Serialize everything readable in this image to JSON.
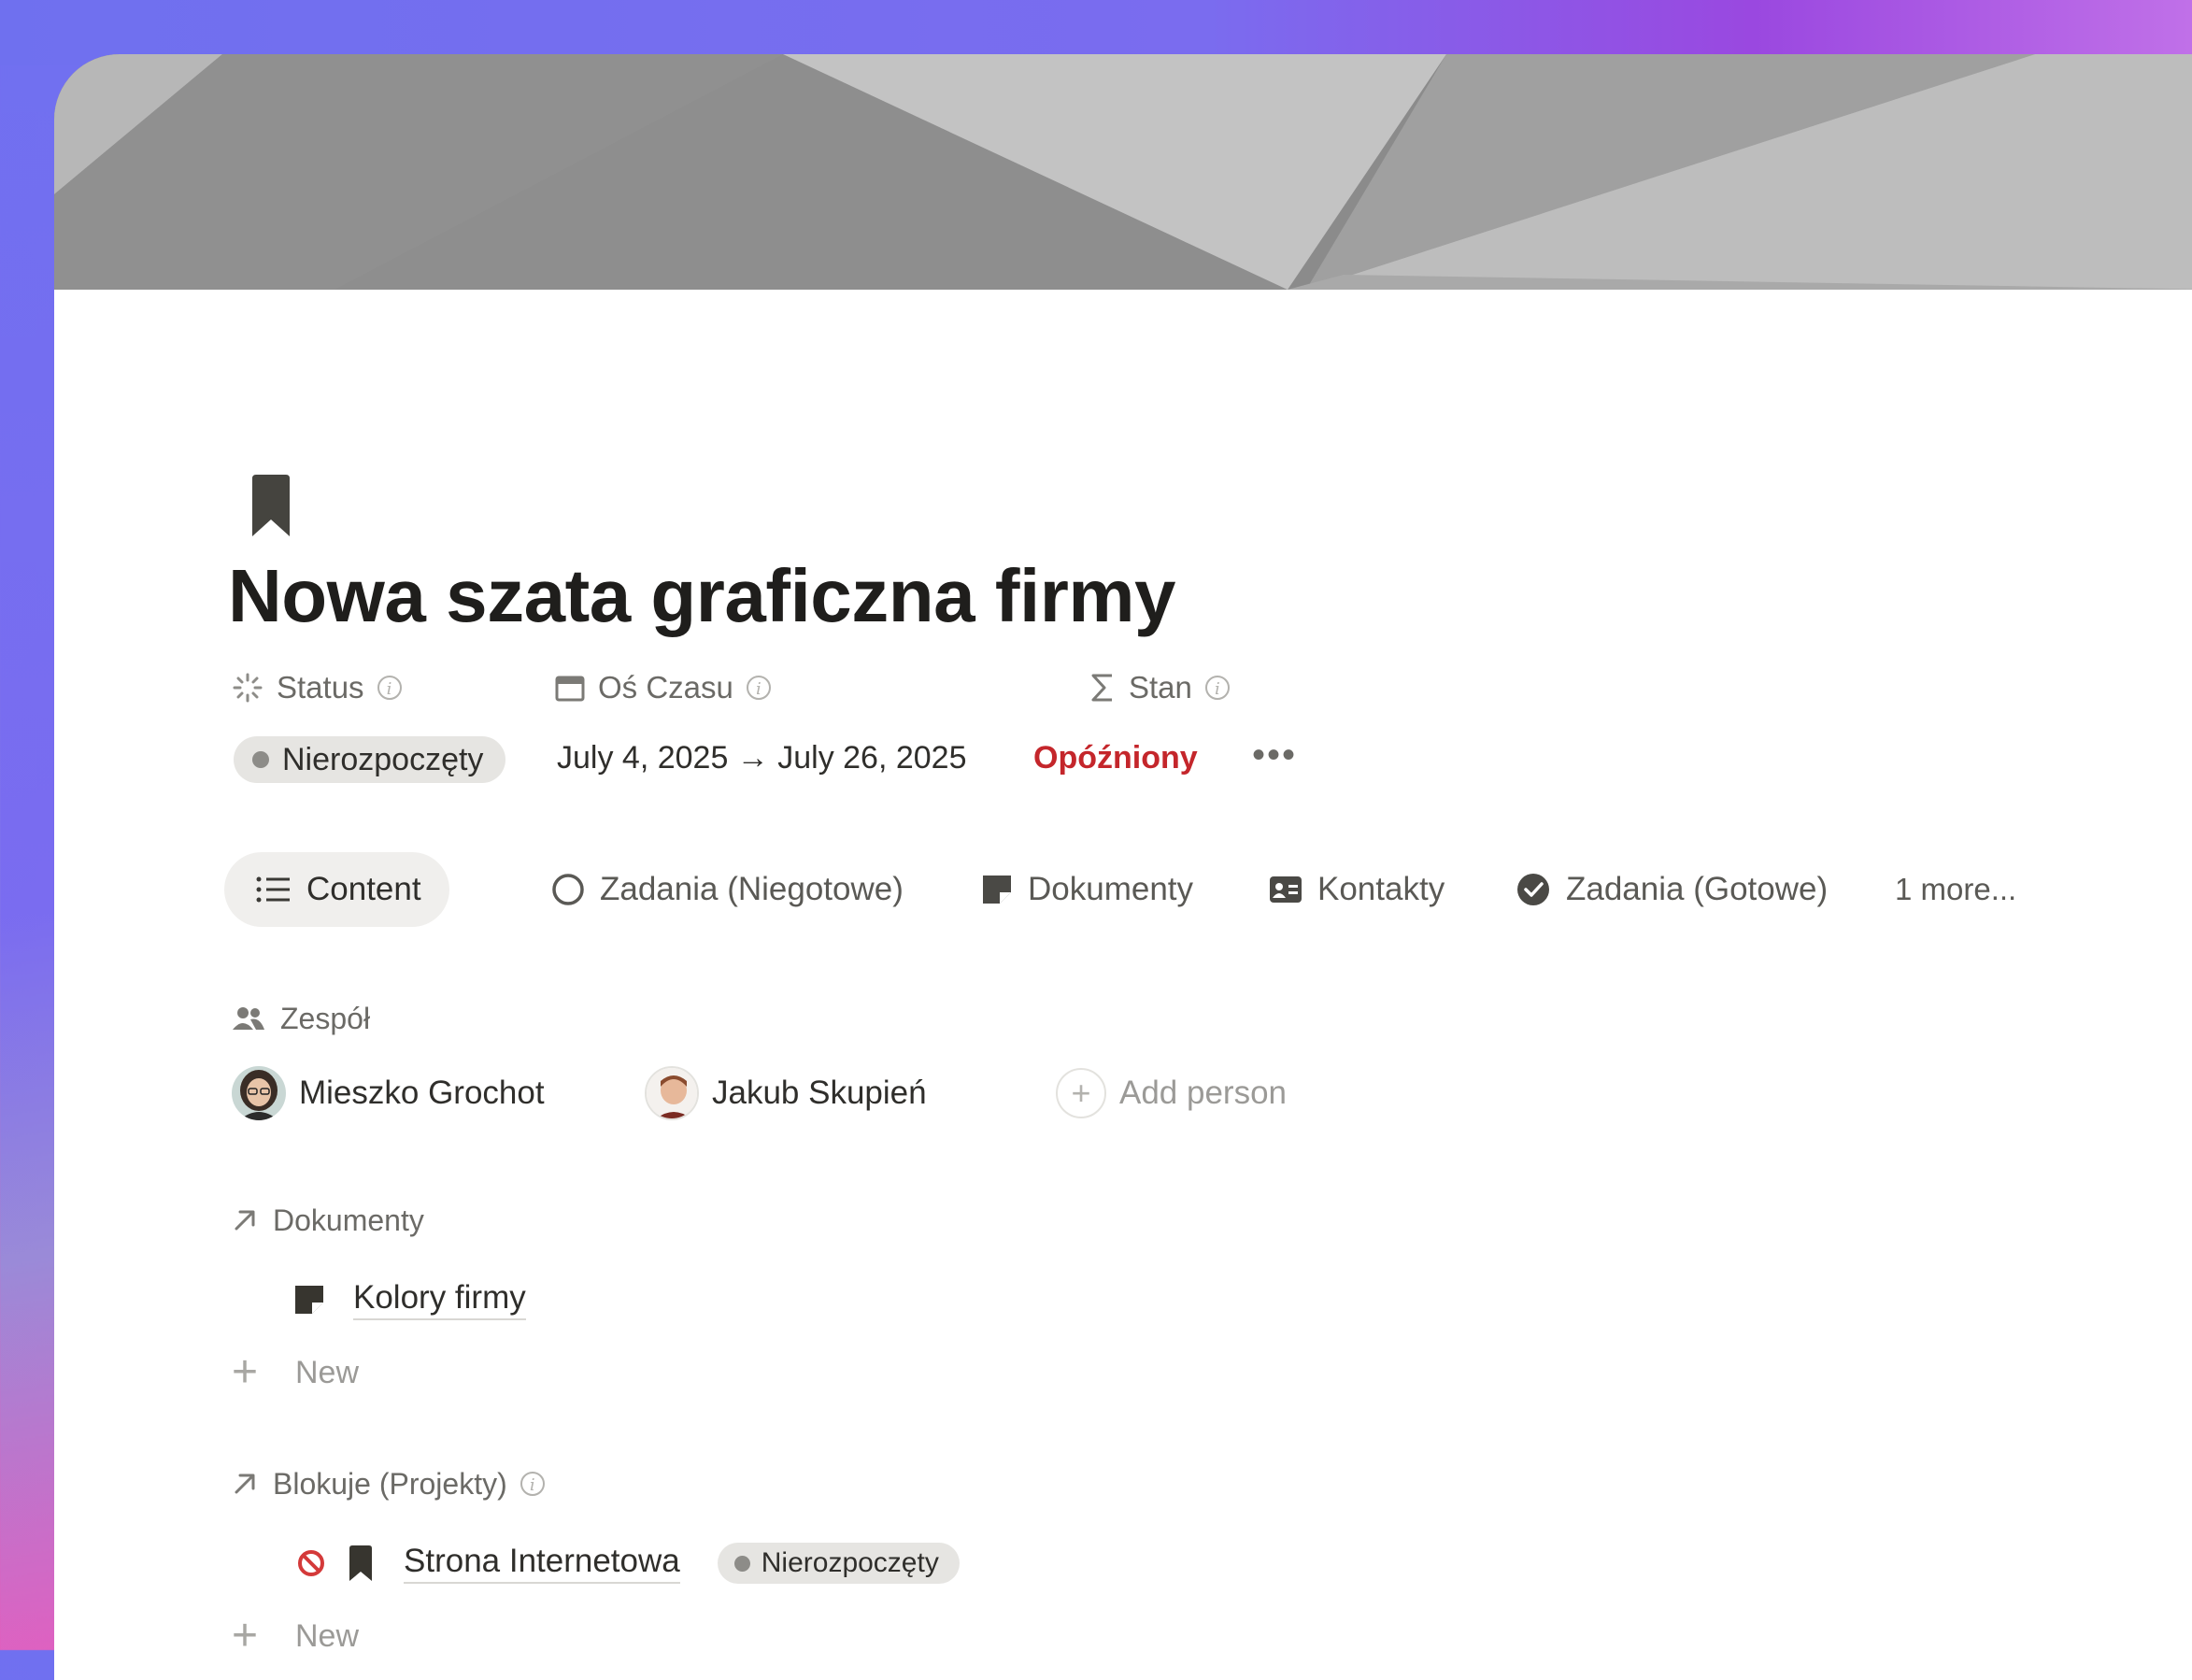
{
  "page": {
    "title": "Nowa szata graficzna firmy",
    "icon": "bookmark-icon"
  },
  "properties": {
    "status": {
      "label": "Status",
      "icon": "status-spinner-icon",
      "value": "Nierozpoczęty"
    },
    "timeline": {
      "label": "Oś Czasu",
      "icon": "calendar-icon",
      "value": "July 4, 2025 → July 26, 2025"
    },
    "stan": {
      "label": "Stan",
      "icon": "sigma-icon",
      "value": "Opóźniony",
      "color": "#c4262b"
    },
    "more": "•••"
  },
  "tabs": [
    {
      "label": "Content",
      "icon": "list-icon",
      "active": true
    },
    {
      "label": "Zadania (Niegotowe)",
      "icon": "circle-icon"
    },
    {
      "label": "Dokumenty",
      "icon": "note-icon"
    },
    {
      "label": "Kontakty",
      "icon": "contact-card-icon"
    },
    {
      "label": "Zadania (Gotowe)",
      "icon": "check-circle-icon"
    },
    {
      "label": "1 more..."
    }
  ],
  "team": {
    "label": "Zespół",
    "icon": "people-icon",
    "people": [
      {
        "name": "Mieszko Grochot"
      },
      {
        "name": "Jakub Skupień"
      }
    ],
    "add_label": "Add person"
  },
  "documents": {
    "label": "Dokumenty",
    "icon": "arrow-up-right-icon",
    "items": [
      {
        "title": "Kolory firmy",
        "icon": "note-icon"
      }
    ],
    "new_label": "New"
  },
  "blocks": {
    "label": "Blokuje (Projekty)",
    "icon": "arrow-up-right-icon",
    "items": [
      {
        "title": "Strona Internetowa",
        "icon": "bookmark-icon",
        "status": "Nierozpoczęty",
        "blocked_icon": "prohibited-icon"
      }
    ],
    "new_label": "New"
  }
}
